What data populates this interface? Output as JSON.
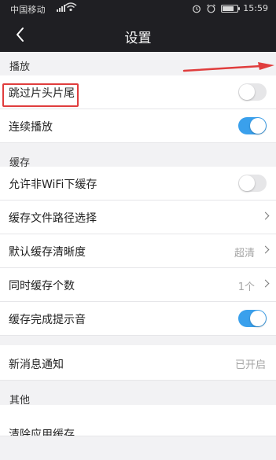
{
  "status_bar": {
    "carrier": "中国移动",
    "time": "15:59",
    "battery_level": 0.8
  },
  "header": {
    "title": "设置"
  },
  "sections": {
    "playback": {
      "title": "播放",
      "skip_label": "跳过片头片尾",
      "skip_on": false,
      "continuous_label": "连续播放",
      "continuous_on": true
    },
    "cache": {
      "title": "缓存",
      "non_wifi_label": "允许非WiFi下缓存",
      "non_wifi_on": false,
      "path_label": "缓存文件路径选择",
      "quality_label": "默认缓存清晰度",
      "quality_value": "超清",
      "count_label": "同时缓存个数",
      "count_value": "1个",
      "sound_label": "缓存完成提示音",
      "sound_on": true
    },
    "notify": {
      "label": "新消息通知",
      "value": "已开启"
    },
    "other": {
      "title": "其他",
      "partial_label": "清除应用缓存"
    }
  },
  "colors": {
    "toggle_on": "#3aa0ec",
    "annotation": "#e03d3d",
    "topbar": "#1f1f23"
  }
}
